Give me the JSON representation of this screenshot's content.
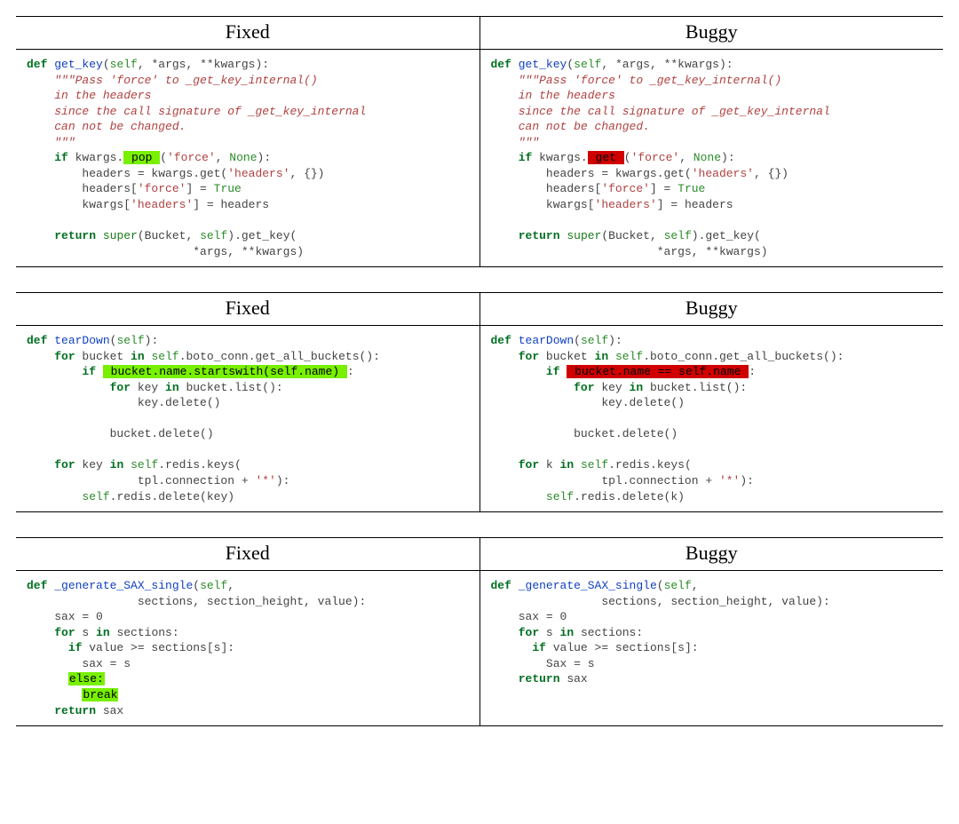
{
  "headers": {
    "fixed": "Fixed",
    "buggy": "Buggy"
  },
  "examples": [
    {
      "fixed": [
        [
          [
            "kw",
            "def "
          ],
          [
            "def",
            "get_key"
          ],
          [
            "p",
            "("
          ],
          [
            "self",
            "self"
          ],
          [
            "p",
            ", *args, **kwargs):"
          ]
        ],
        [
          [
            "p",
            "    "
          ],
          [
            "doc",
            "\"\"\"Pass 'force' to _get_key_internal()"
          ]
        ],
        [
          [
            "p",
            "    "
          ],
          [
            "doc",
            "in the headers"
          ]
        ],
        [
          [
            "p",
            "    "
          ],
          [
            "doc",
            "since the call signature of _get_key_internal"
          ]
        ],
        [
          [
            "p",
            "    "
          ],
          [
            "doc",
            "can not be changed."
          ]
        ],
        [
          [
            "p",
            "    "
          ],
          [
            "doc",
            "\"\"\""
          ]
        ],
        [
          [
            "p",
            "    "
          ],
          [
            "kw",
            "if"
          ],
          [
            "p",
            " kwargs."
          ],
          [
            "hlg",
            " pop "
          ],
          [
            "p",
            "("
          ],
          [
            "str",
            "'force'"
          ],
          [
            "p",
            ", "
          ],
          [
            "none",
            "None"
          ],
          [
            "p",
            "):"
          ]
        ],
        [
          [
            "p",
            "        headers = kwargs.get("
          ],
          [
            "str",
            "'headers'"
          ],
          [
            "p",
            ", {})"
          ]
        ],
        [
          [
            "p",
            "        headers["
          ],
          [
            "str",
            "'force'"
          ],
          [
            "p",
            "] = "
          ],
          [
            "bool",
            "True"
          ]
        ],
        [
          [
            "p",
            "        kwargs["
          ],
          [
            "str",
            "'headers'"
          ],
          [
            "p",
            "] = headers"
          ]
        ],
        [
          [
            "p",
            ""
          ]
        ],
        [
          [
            "p",
            "    "
          ],
          [
            "kw",
            "return"
          ],
          [
            "p",
            " "
          ],
          [
            "var",
            "super"
          ],
          [
            "p",
            "(Bucket, "
          ],
          [
            "self",
            "self"
          ],
          [
            "p",
            ").get_key("
          ]
        ],
        [
          [
            "p",
            "                        *args, **kwargs)"
          ]
        ]
      ],
      "buggy": [
        [
          [
            "kw",
            "def "
          ],
          [
            "def",
            "get_key"
          ],
          [
            "p",
            "("
          ],
          [
            "self",
            "self"
          ],
          [
            "p",
            ", *args, **kwargs):"
          ]
        ],
        [
          [
            "p",
            "    "
          ],
          [
            "doc",
            "\"\"\"Pass 'force' to _get_key_internal()"
          ]
        ],
        [
          [
            "p",
            "    "
          ],
          [
            "doc",
            "in the headers"
          ]
        ],
        [
          [
            "p",
            "    "
          ],
          [
            "doc",
            "since the call signature of _get_key_internal"
          ]
        ],
        [
          [
            "p",
            "    "
          ],
          [
            "doc",
            "can not be changed."
          ]
        ],
        [
          [
            "p",
            "    "
          ],
          [
            "doc",
            "\"\"\""
          ]
        ],
        [
          [
            "p",
            "    "
          ],
          [
            "kw",
            "if"
          ],
          [
            "p",
            " kwargs."
          ],
          [
            "hlr",
            " get "
          ],
          [
            "p",
            "("
          ],
          [
            "str",
            "'force'"
          ],
          [
            "p",
            ", "
          ],
          [
            "none",
            "None"
          ],
          [
            "p",
            "):"
          ]
        ],
        [
          [
            "p",
            "        headers = kwargs.get("
          ],
          [
            "str",
            "'headers'"
          ],
          [
            "p",
            ", {})"
          ]
        ],
        [
          [
            "p",
            "        headers["
          ],
          [
            "str",
            "'force'"
          ],
          [
            "p",
            "] = "
          ],
          [
            "bool",
            "True"
          ]
        ],
        [
          [
            "p",
            "        kwargs["
          ],
          [
            "str",
            "'headers'"
          ],
          [
            "p",
            "] = headers"
          ]
        ],
        [
          [
            "p",
            ""
          ]
        ],
        [
          [
            "p",
            "    "
          ],
          [
            "kw",
            "return"
          ],
          [
            "p",
            " "
          ],
          [
            "var",
            "super"
          ],
          [
            "p",
            "(Bucket, "
          ],
          [
            "self",
            "self"
          ],
          [
            "p",
            ").get_key("
          ]
        ],
        [
          [
            "p",
            "                        *args, **kwargs)"
          ]
        ]
      ]
    },
    {
      "fixed": [
        [
          [
            "kw",
            "def "
          ],
          [
            "def",
            "tearDown"
          ],
          [
            "p",
            "("
          ],
          [
            "self",
            "self"
          ],
          [
            "p",
            "):"
          ]
        ],
        [
          [
            "p",
            "    "
          ],
          [
            "kw",
            "for"
          ],
          [
            "p",
            " bucket "
          ],
          [
            "kw",
            "in"
          ],
          [
            "p",
            " "
          ],
          [
            "self",
            "self"
          ],
          [
            "p",
            ".boto_conn.get_all_buckets():"
          ]
        ],
        [
          [
            "p",
            "        "
          ],
          [
            "kw",
            "if"
          ],
          [
            "p",
            " "
          ],
          [
            "hlg",
            " bucket.name.startswith(self.name) "
          ],
          [
            "p",
            ":"
          ]
        ],
        [
          [
            "p",
            "            "
          ],
          [
            "kw",
            "for"
          ],
          [
            "p",
            " key "
          ],
          [
            "kw",
            "in"
          ],
          [
            "p",
            " bucket.list():"
          ]
        ],
        [
          [
            "p",
            "                key.delete()"
          ]
        ],
        [
          [
            "p",
            ""
          ]
        ],
        [
          [
            "p",
            "            bucket.delete()"
          ]
        ],
        [
          [
            "p",
            ""
          ]
        ],
        [
          [
            "p",
            "    "
          ],
          [
            "kw",
            "for"
          ],
          [
            "p",
            " key "
          ],
          [
            "kw",
            "in"
          ],
          [
            "p",
            " "
          ],
          [
            "self",
            "self"
          ],
          [
            "p",
            ".redis.keys("
          ]
        ],
        [
          [
            "p",
            "                tpl.connection + "
          ],
          [
            "str",
            "'*'"
          ],
          [
            "p",
            "):"
          ]
        ],
        [
          [
            "p",
            "        "
          ],
          [
            "self",
            "self"
          ],
          [
            "p",
            ".redis.delete(key)"
          ]
        ]
      ],
      "buggy": [
        [
          [
            "kw",
            "def "
          ],
          [
            "def",
            "tearDown"
          ],
          [
            "p",
            "("
          ],
          [
            "self",
            "self"
          ],
          [
            "p",
            "):"
          ]
        ],
        [
          [
            "p",
            "    "
          ],
          [
            "kw",
            "for"
          ],
          [
            "p",
            " bucket "
          ],
          [
            "kw",
            "in"
          ],
          [
            "p",
            " "
          ],
          [
            "self",
            "self"
          ],
          [
            "p",
            ".boto_conn.get_all_buckets():"
          ]
        ],
        [
          [
            "p",
            "        "
          ],
          [
            "kw",
            "if"
          ],
          [
            "p",
            " "
          ],
          [
            "hlr",
            " bucket.name == self.name "
          ],
          [
            "p",
            ":"
          ]
        ],
        [
          [
            "p",
            "            "
          ],
          [
            "kw",
            "for"
          ],
          [
            "p",
            " key "
          ],
          [
            "kw",
            "in"
          ],
          [
            "p",
            " bucket.list():"
          ]
        ],
        [
          [
            "p",
            "                key.delete()"
          ]
        ],
        [
          [
            "p",
            ""
          ]
        ],
        [
          [
            "p",
            "            bucket.delete()"
          ]
        ],
        [
          [
            "p",
            ""
          ]
        ],
        [
          [
            "p",
            "    "
          ],
          [
            "kw",
            "for"
          ],
          [
            "p",
            " k "
          ],
          [
            "kw",
            "in"
          ],
          [
            "p",
            " "
          ],
          [
            "self",
            "self"
          ],
          [
            "p",
            ".redis.keys("
          ]
        ],
        [
          [
            "p",
            "                tpl.connection + "
          ],
          [
            "str",
            "'*'"
          ],
          [
            "p",
            "):"
          ]
        ],
        [
          [
            "p",
            "        "
          ],
          [
            "self",
            "self"
          ],
          [
            "p",
            ".redis.delete(k)"
          ]
        ]
      ]
    },
    {
      "fixed": [
        [
          [
            "kw",
            "def "
          ],
          [
            "def",
            "_generate_SAX_single"
          ],
          [
            "p",
            "("
          ],
          [
            "self",
            "self"
          ],
          [
            "p",
            ","
          ]
        ],
        [
          [
            "p",
            "                sections, section_height, value):"
          ]
        ],
        [
          [
            "p",
            "    sax = "
          ],
          [
            "num",
            "0"
          ]
        ],
        [
          [
            "p",
            "    "
          ],
          [
            "kw",
            "for"
          ],
          [
            "p",
            " s "
          ],
          [
            "kw",
            "in"
          ],
          [
            "p",
            " sections:"
          ]
        ],
        [
          [
            "p",
            "      "
          ],
          [
            "kw",
            "if"
          ],
          [
            "p",
            " value >= sections[s]:"
          ]
        ],
        [
          [
            "p",
            "        sax = s"
          ]
        ],
        [
          [
            "p",
            "      "
          ],
          [
            "hlg",
            "else:"
          ]
        ],
        [
          [
            "p",
            "        "
          ],
          [
            "hlg",
            "break"
          ]
        ],
        [
          [
            "p",
            "    "
          ],
          [
            "kw",
            "return"
          ],
          [
            "p",
            " sax"
          ]
        ]
      ],
      "buggy": [
        [
          [
            "kw",
            "def "
          ],
          [
            "def",
            "_generate_SAX_single"
          ],
          [
            "p",
            "("
          ],
          [
            "self",
            "self"
          ],
          [
            "p",
            ","
          ]
        ],
        [
          [
            "p",
            "                sections, section_height, value):"
          ]
        ],
        [
          [
            "p",
            "    sax = "
          ],
          [
            "num",
            "0"
          ]
        ],
        [
          [
            "p",
            "    "
          ],
          [
            "kw",
            "for"
          ],
          [
            "p",
            " s "
          ],
          [
            "kw",
            "in"
          ],
          [
            "p",
            " sections:"
          ]
        ],
        [
          [
            "p",
            "      "
          ],
          [
            "kw",
            "if"
          ],
          [
            "p",
            " value >= sections[s]:"
          ]
        ],
        [
          [
            "p",
            "        Sax = s"
          ]
        ],
        [
          [
            "p",
            "    "
          ],
          [
            "kw",
            "return"
          ],
          [
            "p",
            " sax"
          ]
        ]
      ]
    }
  ]
}
